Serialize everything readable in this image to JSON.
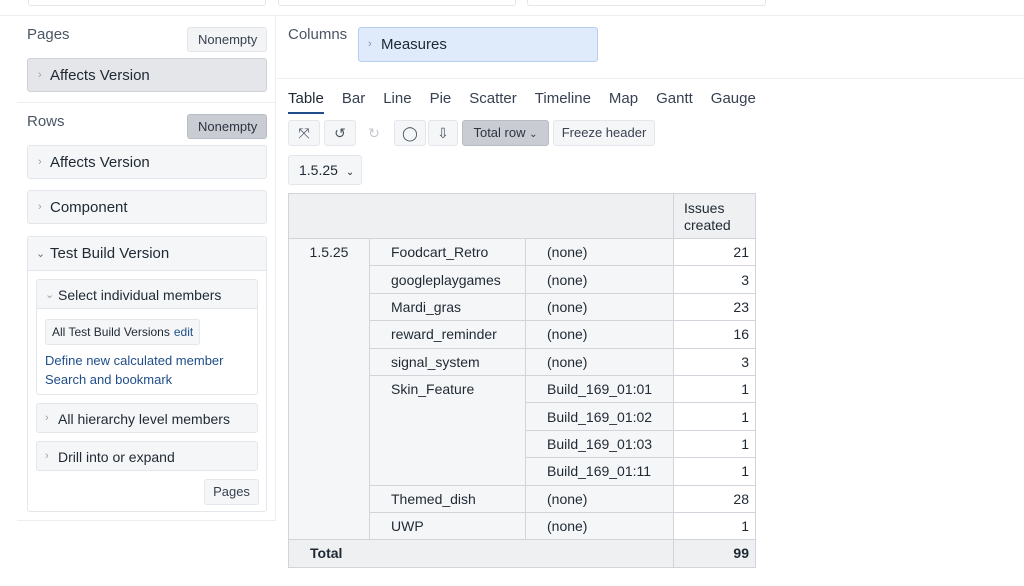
{
  "left": {
    "pages": {
      "label": "Pages",
      "nonempty_label": "Nonempty",
      "item": "Affects Version"
    },
    "rows": {
      "label": "Rows",
      "nonempty_label": "Nonempty",
      "items": [
        "Affects Version",
        "Component"
      ],
      "expanded_item": "Test Build Version",
      "select_members": "Select individual members",
      "chip_label": "All Test Build Versions",
      "chip_edit": "edit",
      "define_link": "Define new calculated member",
      "search_link": "Search and bookmark",
      "all_levels": "All hierarchy level members",
      "drill": "Drill into or expand",
      "pages_button": "Pages"
    }
  },
  "columns": {
    "label": "Columns",
    "item": "Measures"
  },
  "tabs": [
    "Table",
    "Bar",
    "Line",
    "Pie",
    "Scatter",
    "Timeline",
    "Map",
    "Gantt",
    "Gauge"
  ],
  "toolbar": {
    "icons": [
      "expand-icon",
      "undo-icon",
      "redo-icon",
      "comment-icon",
      "download-icon"
    ],
    "total_row": "Total row",
    "freeze_header": "Freeze header"
  },
  "filter": {
    "value": "1.5.25"
  },
  "table": {
    "header": "Issues created",
    "group": "1.5.25",
    "rows": [
      {
        "component": "Foodcart_Retro",
        "build": "(none)",
        "value": "21"
      },
      {
        "component": "googleplaygames",
        "build": "(none)",
        "value": "3"
      },
      {
        "component": "Mardi_gras",
        "build": "(none)",
        "value": "23"
      },
      {
        "component": "reward_reminder",
        "build": "(none)",
        "value": "16"
      },
      {
        "component": "signal_system",
        "build": "(none)",
        "value": "3"
      },
      {
        "component": "Skin_Feature",
        "build": "Build_169_01:01",
        "value": "1"
      },
      {
        "component": "",
        "build": "Build_169_01:02",
        "value": "1"
      },
      {
        "component": "",
        "build": "Build_169_01:03",
        "value": "1"
      },
      {
        "component": "",
        "build": "Build_169_01:11",
        "value": "1"
      },
      {
        "component": "Themed_dish",
        "build": "(none)",
        "value": "28"
      },
      {
        "component": "UWP",
        "build": "(none)",
        "value": "1"
      }
    ],
    "total_label": "Total",
    "total_value": "99"
  }
}
